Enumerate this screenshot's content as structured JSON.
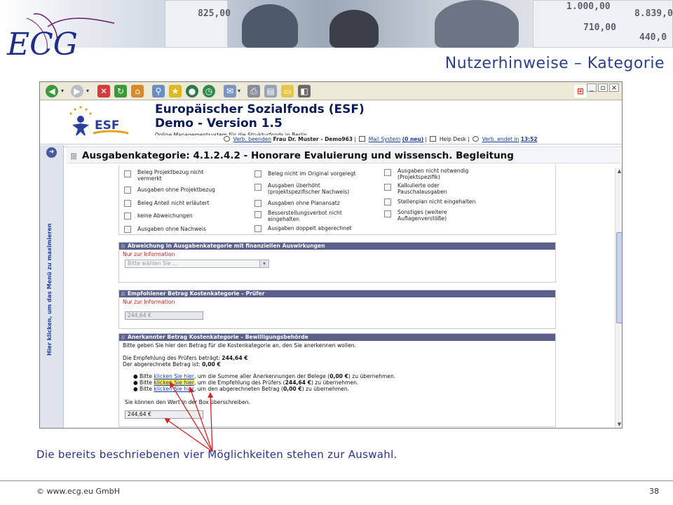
{
  "slide": {
    "title": "Nutzerhinweise – Kategorie",
    "caption": "Die bereits beschriebenen vier Möglichkeiten stehen zur Auswahl.",
    "footer_left": "© www.ecg.eu GmbH",
    "footer_right": "38",
    "logo_text": "ECG",
    "banner_numbers": [
      "825,00",
      "8.839,0",
      "1.000,00",
      "710,00",
      "440,0"
    ]
  },
  "browser": {
    "toolbar_icons": [
      "back-icon",
      "forward-icon",
      "stop-icon",
      "refresh-icon",
      "home-icon",
      "search-icon",
      "favorites-icon",
      "media-icon",
      "history-icon",
      "mail-icon",
      "print-icon",
      "edit-icon",
      "folder-icon",
      "messenger-icon"
    ],
    "window_controls": [
      "_",
      "▫",
      "×"
    ]
  },
  "app": {
    "logo_text": "ESF",
    "title": "Europäischer Sozialfonds (ESF)",
    "version": "Demo - Version 1.5",
    "subtitle": "Online Managementsystem für die Strukturfonds in Berlin.",
    "user_bar": {
      "logout_link": "Verb. beenden",
      "user": "Frau Dr. Muster - Demo963",
      "mail_link": "Mail System",
      "mail_count": "(0 neu)",
      "helpdesk": "Help Desk",
      "session_link": "Verb. endet in",
      "session_time": "13:52"
    },
    "side_tab_label": "Hier klicken, um das Menü zu maximieren",
    "category_title": "Ausgabenkategorie: 4.1.2.4.2 - Honorare Evaluierung und wissensch. Begleitung"
  },
  "checkboxes": [
    {
      "label": "Beleg Projektbezug nicht vermerkt"
    },
    {
      "label": "Ausgaben ohne Projektbezug"
    },
    {
      "label": "Beleg Anteil nicht erläutert"
    },
    {
      "label": "keine Abweichungen"
    },
    {
      "label": "Ausgaben ohne Nachweis"
    },
    {
      "label": "Beleg nicht im Original vorgelegt"
    },
    {
      "label": "Ausgaben überhöht (projektspezifischer Nachweis)"
    },
    {
      "label": "Ausgaben ohne Planansatz"
    },
    {
      "label": "Besserstellungsverbot nicht eingehalten"
    },
    {
      "label": "Ausgaben doppelt abgerechnet"
    },
    {
      "label": "Ausgaben nicht notwendig (Projektspezifik)"
    },
    {
      "label": "Kalkulierte oder Pauschalausgaben"
    },
    {
      "label": "Stellenplan nicht eingehalten"
    },
    {
      "label": "Sonstiges (weitere Auflagenverstöße)"
    }
  ],
  "panel_abweichung": {
    "heading": "Abweichung in Ausgabenkategorie mit finanziellen Auswirkungen",
    "note": "Nur zur Information",
    "select_value": "Bitte wählen Sie ..."
  },
  "panel_empfohlen": {
    "heading": "Empfohlener Betrag Kostenkategorie – Prüfer",
    "note": "Nur zur Information",
    "value": "244,64 €"
  },
  "panel_anerkannt": {
    "heading": "Anerkannter Betrag Kostenkategorie – Bewilligungsbehörde",
    "intro": "Bitte geben Sie hier den Betrag für die Kostenkategorie an, den Sie anerkennen wollen.",
    "pruefer_label": "Die Empfehlung des Prüfers beträgt:",
    "pruefer_value": "244,64 €",
    "abgerechnet_label": "Der abgerechnete Betrag ist:",
    "abgerechnet_value": "0,00 €",
    "bullet_prefix": "Bitte",
    "link_text": "klicken Sie hier",
    "bullet_1": ", um die Summe aller Anerkennungen der Belege (",
    "bullet_1_value": "0,00 €",
    "bullet_1_end": ") zu übernehmen.",
    "bullet_2": ", um die Empfehlung des Prüfers (",
    "bullet_2_value": "244,64 €",
    "bullet_2_end": ") zu übernehmen.",
    "bullet_3": ", um den abgerechneten Betrag (",
    "bullet_3_value": "0,00 €",
    "bullet_3_end": ") zu übernehmen.",
    "override_note": "Sie können den Wert in der Box überschreiben.",
    "input_value": "244,64 €"
  },
  "colors": {
    "title_blue": "#2a3f8f",
    "panel_header": "#5b5f8a",
    "note_red": "#d01c1c",
    "link_blue": "#1d3fb6",
    "arrow_red": "#e02020"
  }
}
